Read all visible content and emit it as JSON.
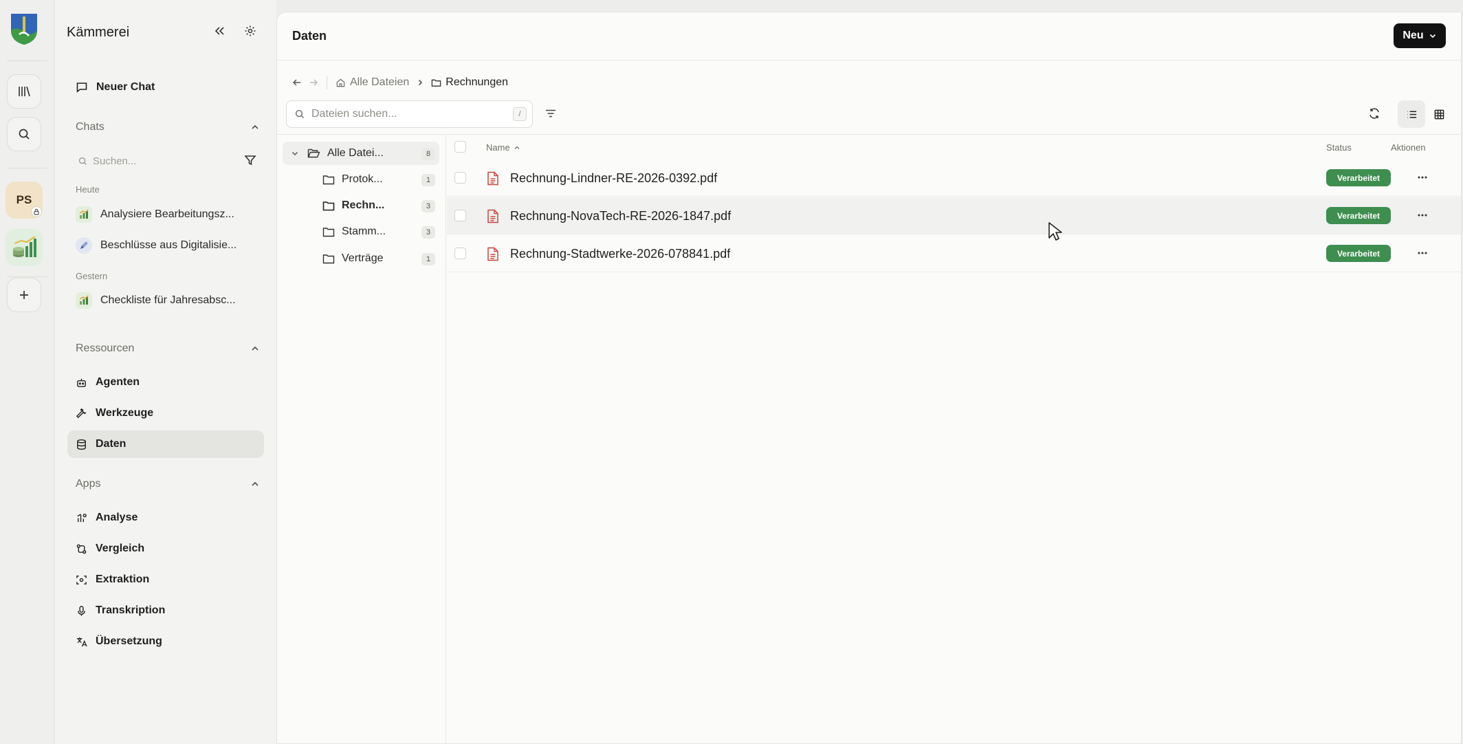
{
  "rail": {
    "avatar_initials": "PS"
  },
  "sidebar": {
    "title": "Kämmerei",
    "new_chat": "Neuer Chat",
    "chats_section": "Chats",
    "search_placeholder": "Suchen...",
    "today_label": "Heute",
    "yesterday_label": "Gestern",
    "chats_today": [
      {
        "title": "Analysiere Bearbeitungsz...",
        "icon": "chart-icon"
      },
      {
        "title": "Beschlüsse aus Digitalisie...",
        "icon": "pen-icon"
      }
    ],
    "chats_yesterday": [
      {
        "title": "Checkliste für Jahresabsc...",
        "icon": "chart-icon"
      }
    ],
    "resources_section": "Ressourcen",
    "resources": [
      {
        "label": "Agenten",
        "icon": "bot-icon"
      },
      {
        "label": "Werkzeuge",
        "icon": "wrench-icon"
      },
      {
        "label": "Daten",
        "icon": "database-icon"
      }
    ],
    "apps_section": "Apps",
    "apps": [
      {
        "label": "Analyse",
        "icon": "analysis-icon"
      },
      {
        "label": "Vergleich",
        "icon": "compare-icon"
      },
      {
        "label": "Extraktion",
        "icon": "scan-icon"
      },
      {
        "label": "Transkription",
        "icon": "mic-icon"
      },
      {
        "label": "Übersetzung",
        "icon": "translate-icon"
      }
    ]
  },
  "main": {
    "title": "Daten",
    "new_button": "Neu",
    "breadcrumb": {
      "root": "Alle Dateien",
      "current": "Rechnungen"
    },
    "search_placeholder": "Dateien suchen...",
    "search_shortcut": "/",
    "tree": {
      "root": {
        "label": "Alle Datei...",
        "count": "8"
      },
      "folders": [
        {
          "label": "Protok...",
          "count": "1"
        },
        {
          "label": "Rechn...",
          "count": "3"
        },
        {
          "label": "Stamm...",
          "count": "3"
        },
        {
          "label": "Verträge",
          "count": "1"
        }
      ]
    },
    "table": {
      "col_name": "Name",
      "col_status": "Status",
      "col_actions": "Aktionen",
      "rows": [
        {
          "name": "Rechnung-Lindner-RE-2026-0392.pdf",
          "status": "Verarbeitet"
        },
        {
          "name": "Rechnung-NovaTech-RE-2026-1847.pdf",
          "status": "Verarbeitet"
        },
        {
          "name": "Rechnung-Stadtwerke-2026-078841.pdf",
          "status": "Verarbeitet"
        }
      ]
    }
  },
  "colors": {
    "accent": "#121212",
    "status_green": "#3e8e50",
    "pdf_red": "#c9463d"
  }
}
